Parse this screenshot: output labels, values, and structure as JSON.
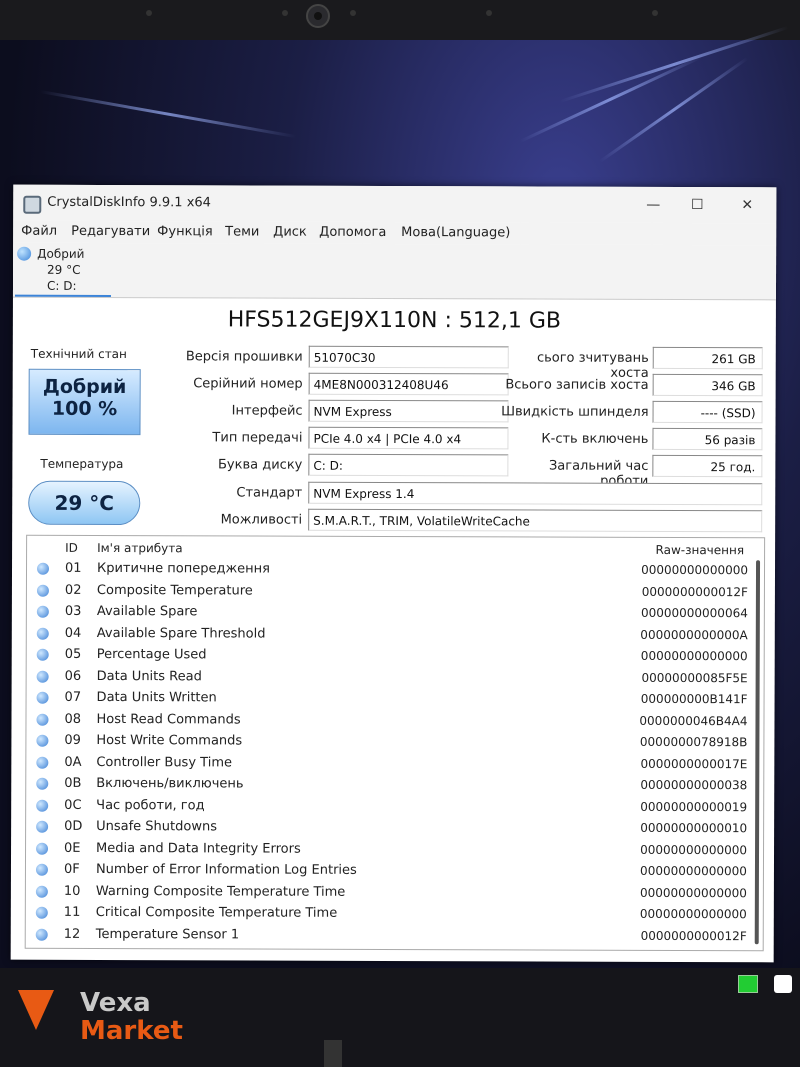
{
  "window": {
    "title": "CrystalDiskInfo 9.9.1 x64",
    "minimize": "—",
    "maximize": "☐",
    "close": "✕"
  },
  "menu": [
    "Файл",
    "Редагувати",
    "Функція",
    "Теми",
    "Диск",
    "Допомога",
    "Мова(Language)"
  ],
  "disk_tab": {
    "status": "Добрий",
    "temp": "29 °C",
    "letters": "C: D:"
  },
  "model": "HFS512GEJ9X110N : 512,1 GB",
  "health": {
    "label": "Технічний стан",
    "status": "Добрий",
    "percent": "100 %"
  },
  "temperature": {
    "label": "Температура",
    "value": "29 °C"
  },
  "info_left": [
    {
      "label": "Версія прошивки",
      "value": "51070C30"
    },
    {
      "label": "Серійний номер",
      "value": "4ME8N000312408U46"
    },
    {
      "label": "Інтерфейс",
      "value": "NVM Express"
    },
    {
      "label": "Тип передачі",
      "value": "PCIe 4.0 x4 | PCIe 4.0 x4"
    },
    {
      "label": "Буква диску",
      "value": "C: D:"
    }
  ],
  "info_right": [
    {
      "label": "сього зчитувань хоста",
      "value": "261 GB"
    },
    {
      "label": "Всього записів хоста",
      "value": "346 GB"
    },
    {
      "label": "Швидкість шпинделя",
      "value": "---- (SSD)"
    },
    {
      "label": "К-сть включень",
      "value": "56 разів"
    },
    {
      "label": "Загальний час роботи",
      "value": "25 год."
    }
  ],
  "standard": {
    "label": "Стандарт",
    "value": "NVM Express 1.4"
  },
  "features": {
    "label": "Можливості",
    "value": "S.M.A.R.T., TRIM, VolatileWriteCache"
  },
  "attributes": {
    "headers": {
      "id": "ID",
      "name": "Ім'я атрибута",
      "raw": "Raw-значення"
    },
    "rows": [
      {
        "id": "01",
        "name": "Критичне попередження",
        "raw": "00000000000000"
      },
      {
        "id": "02",
        "name": "Composite Temperature",
        "raw": "0000000000012F"
      },
      {
        "id": "03",
        "name": "Available Spare",
        "raw": "00000000000064"
      },
      {
        "id": "04",
        "name": "Available Spare Threshold",
        "raw": "0000000000000A"
      },
      {
        "id": "05",
        "name": "Percentage Used",
        "raw": "00000000000000"
      },
      {
        "id": "06",
        "name": "Data Units Read",
        "raw": "00000000085F5E"
      },
      {
        "id": "07",
        "name": "Data Units Written",
        "raw": "000000000B141F"
      },
      {
        "id": "08",
        "name": "Host Read Commands",
        "raw": "0000000046B4A4"
      },
      {
        "id": "09",
        "name": "Host Write Commands",
        "raw": "0000000078918B"
      },
      {
        "id": "0A",
        "name": "Controller Busy Time",
        "raw": "0000000000017E"
      },
      {
        "id": "0B",
        "name": "Включень/виключень",
        "raw": "00000000000038"
      },
      {
        "id": "0C",
        "name": "Час роботи, год",
        "raw": "00000000000019"
      },
      {
        "id": "0D",
        "name": "Unsafe Shutdowns",
        "raw": "00000000000010"
      },
      {
        "id": "0E",
        "name": "Media and Data Integrity Errors",
        "raw": "00000000000000"
      },
      {
        "id": "0F",
        "name": "Number of Error Information Log Entries",
        "raw": "00000000000000"
      },
      {
        "id": "10",
        "name": "Warning Composite Temperature Time",
        "raw": "00000000000000"
      },
      {
        "id": "11",
        "name": "Critical Composite Temperature Time",
        "raw": "00000000000000"
      },
      {
        "id": "12",
        "name": "Temperature Sensor 1",
        "raw": "0000000000012F"
      }
    ]
  },
  "watermark": {
    "line1": "Vexa",
    "line2": "Market"
  },
  "colors": {
    "health_good": "#7db6ef",
    "accent": "#3c84d8",
    "watermark_orange": "#e85a14"
  }
}
